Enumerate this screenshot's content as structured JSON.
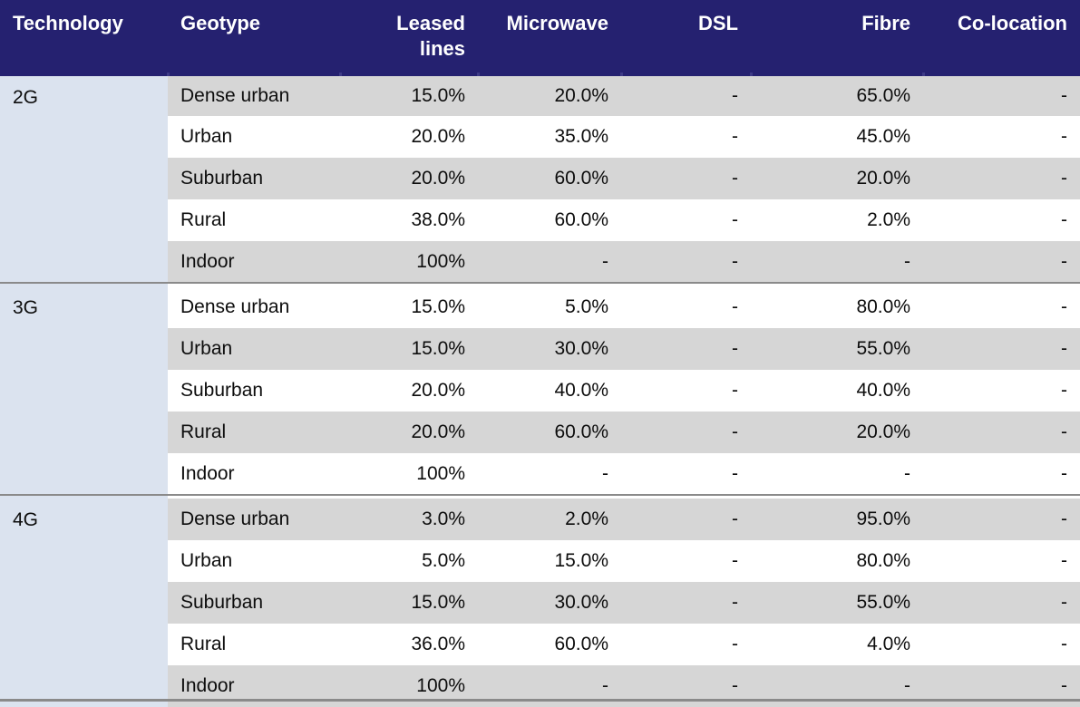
{
  "table": {
    "columns": [
      {
        "key": "technology",
        "label": "Technology",
        "align": "left"
      },
      {
        "key": "geotype",
        "label": "Geotype",
        "align": "left"
      },
      {
        "key": "leased",
        "label": "Leased lines",
        "align": "right"
      },
      {
        "key": "microwave",
        "label": "Microwave",
        "align": "right"
      },
      {
        "key": "dsl",
        "label": "DSL",
        "align": "right"
      },
      {
        "key": "fibre",
        "label": "Fibre",
        "align": "right"
      },
      {
        "key": "colocation",
        "label": "Co-location",
        "align": "right"
      }
    ],
    "header_bg": "#252170",
    "header_fg": "#ffffff",
    "tech_col_bg": "#dbe3ef",
    "row_alt_bg": "#d6d6d6",
    "row_base_bg": "#ffffff",
    "rule_color": "#8a8a8a",
    "groups": [
      {
        "technology": "2G",
        "rows": [
          {
            "geotype": "Dense urban",
            "leased": "15.0%",
            "microwave": "20.0%",
            "dsl": "-",
            "fibre": "65.0%",
            "colocation": "-",
            "shade": "grey"
          },
          {
            "geotype": "Urban",
            "leased": "20.0%",
            "microwave": "35.0%",
            "dsl": "-",
            "fibre": "45.0%",
            "colocation": "-",
            "shade": "white"
          },
          {
            "geotype": "Suburban",
            "leased": "20.0%",
            "microwave": "60.0%",
            "dsl": "-",
            "fibre": "20.0%",
            "colocation": "-",
            "shade": "grey"
          },
          {
            "geotype": "Rural",
            "leased": "38.0%",
            "microwave": "60.0%",
            "dsl": "-",
            "fibre": "2.0%",
            "colocation": "-",
            "shade": "white"
          },
          {
            "geotype": "Indoor",
            "leased": "100%",
            "microwave": "-",
            "dsl": "-",
            "fibre": "-",
            "colocation": "-",
            "shade": "grey"
          }
        ]
      },
      {
        "technology": "3G",
        "rows": [
          {
            "geotype": "Dense urban",
            "leased": "15.0%",
            "microwave": "5.0%",
            "dsl": "-",
            "fibre": "80.0%",
            "colocation": "-",
            "shade": "white"
          },
          {
            "geotype": "Urban",
            "leased": "15.0%",
            "microwave": "30.0%",
            "dsl": "-",
            "fibre": "55.0%",
            "colocation": "-",
            "shade": "grey"
          },
          {
            "geotype": "Suburban",
            "leased": "20.0%",
            "microwave": "40.0%",
            "dsl": "-",
            "fibre": "40.0%",
            "colocation": "-",
            "shade": "white"
          },
          {
            "geotype": "Rural",
            "leased": "20.0%",
            "microwave": "60.0%",
            "dsl": "-",
            "fibre": "20.0%",
            "colocation": "-",
            "shade": "grey"
          },
          {
            "geotype": "Indoor",
            "leased": "100%",
            "microwave": "-",
            "dsl": "-",
            "fibre": "-",
            "colocation": "-",
            "shade": "white"
          }
        ]
      },
      {
        "technology": "4G",
        "rows": [
          {
            "geotype": "Dense urban",
            "leased": "3.0%",
            "microwave": "2.0%",
            "dsl": "-",
            "fibre": "95.0%",
            "colocation": "-",
            "shade": "grey"
          },
          {
            "geotype": "Urban",
            "leased": "5.0%",
            "microwave": "15.0%",
            "dsl": "-",
            "fibre": "80.0%",
            "colocation": "-",
            "shade": "white"
          },
          {
            "geotype": "Suburban",
            "leased": "15.0%",
            "microwave": "30.0%",
            "dsl": "-",
            "fibre": "55.0%",
            "colocation": "-",
            "shade": "grey"
          },
          {
            "geotype": "Rural",
            "leased": "36.0%",
            "microwave": "60.0%",
            "dsl": "-",
            "fibre": "4.0%",
            "colocation": "-",
            "shade": "white"
          },
          {
            "geotype": "Indoor",
            "leased": "100%",
            "microwave": "-",
            "dsl": "-",
            "fibre": "-",
            "colocation": "-",
            "shade": "grey"
          }
        ]
      }
    ]
  }
}
